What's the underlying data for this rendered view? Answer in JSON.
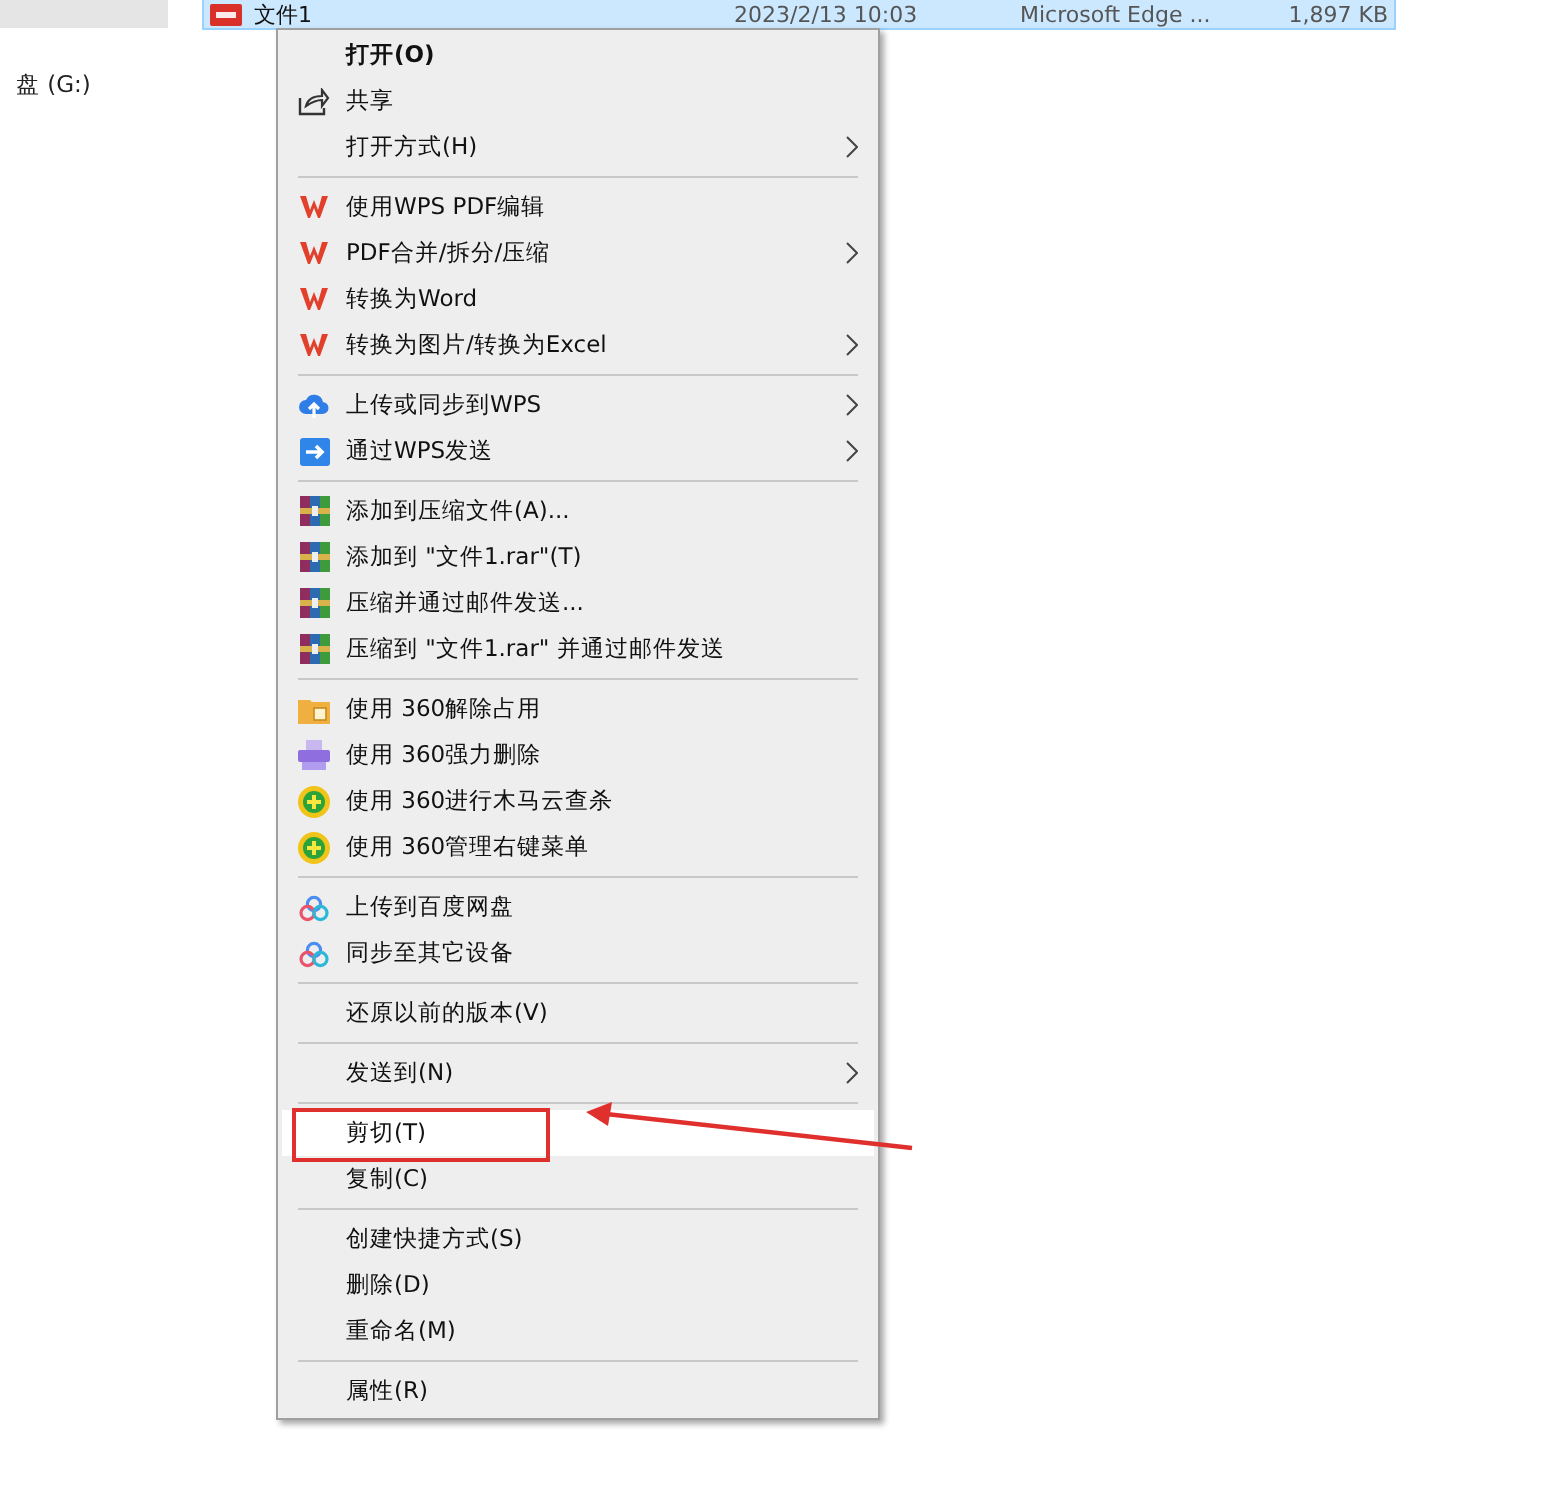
{
  "sidebar": {
    "items": [
      {
        "label": "盘 (G:)",
        "selected": false
      }
    ]
  },
  "file_row": {
    "name": "文件1",
    "date": "2023/2/13 10:03",
    "type": "Microsoft Edge ...",
    "size": "1,897 KB",
    "selected": true
  },
  "context_menu": {
    "items": [
      {
        "kind": "plain",
        "label": "打开(O)",
        "bold": true,
        "submenu": false,
        "selected": false,
        "callout": false
      },
      {
        "kind": "share",
        "label": "共享",
        "bold": false,
        "submenu": false,
        "selected": false,
        "callout": false
      },
      {
        "kind": "plain",
        "label": "打开方式(H)",
        "bold": false,
        "submenu": true,
        "selected": false,
        "callout": false
      },
      {
        "kind": "separator"
      },
      {
        "kind": "wps",
        "label": "使用WPS PDF编辑",
        "bold": false,
        "submenu": false,
        "selected": false,
        "callout": false
      },
      {
        "kind": "wps",
        "label": "PDF合并/拆分/压缩",
        "bold": false,
        "submenu": true,
        "selected": false,
        "callout": false
      },
      {
        "kind": "wps",
        "label": "转换为Word",
        "bold": false,
        "submenu": false,
        "selected": false,
        "callout": false
      },
      {
        "kind": "wps",
        "label": "转换为图片/转换为Excel",
        "bold": false,
        "submenu": true,
        "selected": false,
        "callout": false
      },
      {
        "kind": "separator"
      },
      {
        "kind": "cloud",
        "label": "上传或同步到WPS",
        "bold": false,
        "submenu": true,
        "selected": false,
        "callout": false
      },
      {
        "kind": "send",
        "label": "通过WPS发送",
        "bold": false,
        "submenu": true,
        "selected": false,
        "callout": false
      },
      {
        "kind": "separator"
      },
      {
        "kind": "archive",
        "label": "添加到压缩文件(A)...",
        "bold": false,
        "submenu": false,
        "selected": false,
        "callout": false
      },
      {
        "kind": "archive",
        "label": "添加到 \"文件1.rar\"(T)",
        "bold": false,
        "submenu": false,
        "selected": false,
        "callout": false
      },
      {
        "kind": "archive",
        "label": "压缩并通过邮件发送...",
        "bold": false,
        "submenu": false,
        "selected": false,
        "callout": false
      },
      {
        "kind": "archive",
        "label": "压缩到 \"文件1.rar\" 并通过邮件发送",
        "bold": false,
        "submenu": false,
        "selected": false,
        "callout": false
      },
      {
        "kind": "separator"
      },
      {
        "kind": "folder",
        "label": "使用 360解除占用",
        "bold": false,
        "submenu": false,
        "selected": false,
        "callout": false
      },
      {
        "kind": "shredder",
        "label": "使用 360强力删除",
        "bold": false,
        "submenu": false,
        "selected": false,
        "callout": false
      },
      {
        "kind": "plus",
        "label": "使用 360进行木马云查杀",
        "bold": false,
        "submenu": false,
        "selected": false,
        "callout": false
      },
      {
        "kind": "plus",
        "label": "使用 360管理右键菜单",
        "bold": false,
        "submenu": false,
        "selected": false,
        "callout": false
      },
      {
        "kind": "separator"
      },
      {
        "kind": "rings",
        "label": "上传到百度网盘",
        "bold": false,
        "submenu": false,
        "selected": false,
        "callout": false
      },
      {
        "kind": "rings",
        "label": "同步至其它设备",
        "bold": false,
        "submenu": false,
        "selected": false,
        "callout": false
      },
      {
        "kind": "separator"
      },
      {
        "kind": "plain",
        "label": "还原以前的版本(V)",
        "bold": false,
        "submenu": false,
        "selected": false,
        "callout": false
      },
      {
        "kind": "separator"
      },
      {
        "kind": "plain",
        "label": "发送到(N)",
        "bold": false,
        "submenu": true,
        "selected": false,
        "callout": false
      },
      {
        "kind": "separator"
      },
      {
        "kind": "plain",
        "label": "剪切(T)",
        "bold": false,
        "submenu": false,
        "selected": true,
        "callout": true
      },
      {
        "kind": "plain",
        "label": "复制(C)",
        "bold": false,
        "submenu": false,
        "selected": false,
        "callout": false
      },
      {
        "kind": "separator"
      },
      {
        "kind": "plain",
        "label": "创建快捷方式(S)",
        "bold": false,
        "submenu": false,
        "selected": false,
        "callout": false
      },
      {
        "kind": "plain",
        "label": "删除(D)",
        "bold": false,
        "submenu": false,
        "selected": false,
        "callout": false
      },
      {
        "kind": "plain",
        "label": "重命名(M)",
        "bold": false,
        "submenu": false,
        "selected": false,
        "callout": false
      },
      {
        "kind": "separator"
      },
      {
        "kind": "plain",
        "label": "属性(R)",
        "bold": false,
        "submenu": false,
        "selected": false,
        "callout": false
      }
    ]
  }
}
